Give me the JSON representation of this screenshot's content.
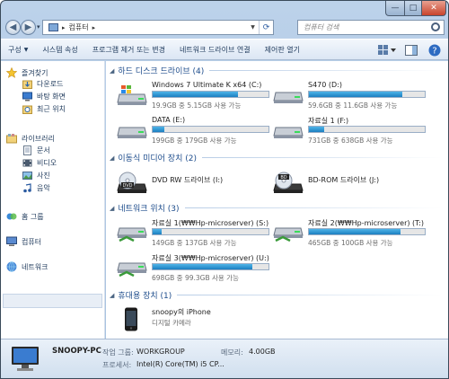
{
  "address": {
    "location": "컴퓨터",
    "chevron": "▸"
  },
  "search": {
    "placeholder": "컴퓨터 검색"
  },
  "window_controls": {
    "minimize": "—",
    "maximize": "□",
    "close": "✕"
  },
  "nav": {
    "back": "◀",
    "forward": "▶",
    "history": "▾"
  },
  "toolbar": {
    "organize": "구성",
    "system_properties": "시스템 속성",
    "uninstall": "프로그램 제거 또는 변경",
    "map_drive": "네트워크 드라이브 연결",
    "control_panel": "제어판 열기"
  },
  "sidebar": {
    "favorites": {
      "label": "즐겨찾기",
      "items": [
        {
          "label": "다운로드"
        },
        {
          "label": "바탕 화면"
        },
        {
          "label": "최근 위치"
        }
      ]
    },
    "libraries": {
      "label": "라이브러리",
      "items": [
        {
          "label": "문서"
        },
        {
          "label": "비디오"
        },
        {
          "label": "사진"
        },
        {
          "label": "음악"
        }
      ]
    },
    "homegroup": {
      "label": "홈 그룹"
    },
    "computer": {
      "label": "컴퓨터"
    },
    "network": {
      "label": "네트워크"
    }
  },
  "sections": {
    "hdd": "하드 디스크 드라이브 (4)",
    "removable": "이동식 미디어 장치 (2)",
    "network": "네트워크 위치 (3)",
    "portable": "휴대용 장치 (1)"
  },
  "drives": [
    {
      "name": "Windows 7 Ultimate K x64 (C:)",
      "free": "19.9GB 중 5.15GB 사용 가능",
      "used_fraction": 0.74
    },
    {
      "name": "S470 (D:)",
      "free": "59.6GB 중 11.6GB 사용 가능",
      "used_fraction": 0.81
    },
    {
      "name": "DATA (E:)",
      "free": "199GB 중 179GB 사용 가능",
      "used_fraction": 0.1
    },
    {
      "name": "자료실 1 (F:)",
      "free": "731GB 중 638GB 사용 가능",
      "used_fraction": 0.13
    }
  ],
  "removable": [
    {
      "name": "DVD RW 드라이브 (I:)",
      "badge": "DVD"
    },
    {
      "name": "BD-ROM 드라이브 (J:)",
      "badge": "BD"
    }
  ],
  "network_drives": [
    {
      "name": "자료실 1(₩₩Hp-microserver) (S:)",
      "free": "149GB 중 137GB 사용 가능",
      "used_fraction": 0.08
    },
    {
      "name": "자료실 2(₩₩Hp-microserver) (T:)",
      "free": "465GB 중 100GB 사용 가능",
      "used_fraction": 0.79
    },
    {
      "name": "자료실 3(₩₩Hp-microserver) (U:)",
      "free": "698GB 중 99.3GB 사용 가능",
      "used_fraction": 0.86
    }
  ],
  "device": {
    "name": "snoopy의 iPhone",
    "type": "디지털 카메라"
  },
  "status": {
    "pc_name": "SNOOPY-PC",
    "workgroup_label": "작업 그룹:",
    "workgroup": "WORKGROUP",
    "memory_label": "메모리:",
    "memory": "4.00GB",
    "cpu_label": "프로세서:",
    "cpu": "Intel(R) Core(TM) i5 CP..."
  },
  "colors": {
    "bar_fill": "#1c7fc0",
    "section_title": "#1e4d8c",
    "accent": "#4fb4e8"
  }
}
